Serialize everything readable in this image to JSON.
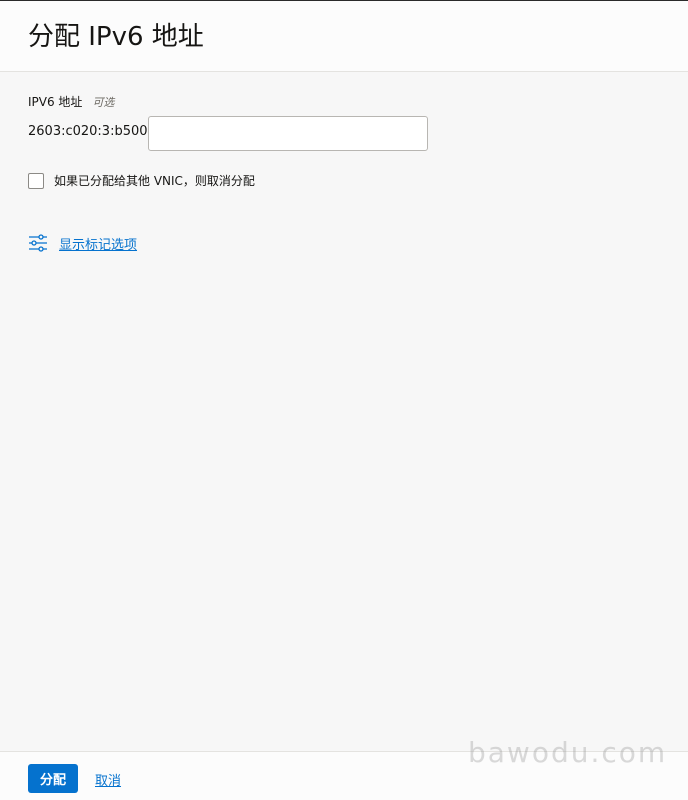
{
  "dialog": {
    "title": "分配 IPv6 地址"
  },
  "form": {
    "ipv6_label": "IPV6 地址",
    "optional_tag": "可选",
    "prefix": "2603:c020:3:b500:",
    "ipv6_value": "",
    "unassign_checkbox_label": "如果已分配给其他 VNIC，则取消分配",
    "unassign_checked": false,
    "show_tags_link": "显示标记选项"
  },
  "footer": {
    "assign_label": "分配",
    "cancel_label": "取消"
  },
  "watermark": {
    "text": "bawodu.com"
  },
  "colors": {
    "accent": "#0572ce",
    "background": "#f7f7f7",
    "header_background": "#fcfcfc"
  },
  "icons": {
    "tag_options": "sliders-icon"
  }
}
